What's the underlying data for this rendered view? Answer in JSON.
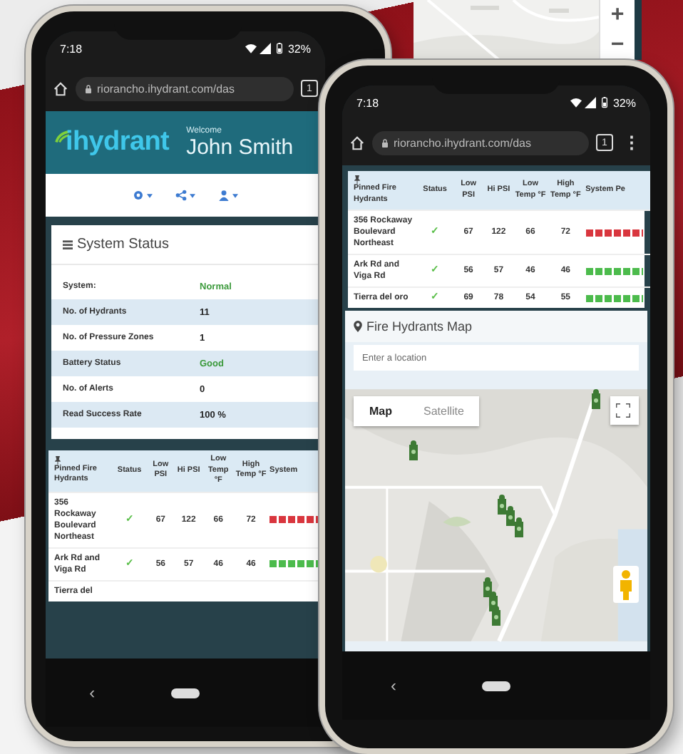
{
  "background": {
    "map_controls": [
      "+",
      "−"
    ]
  },
  "phones": [
    {
      "status_bar": {
        "time": "7:18",
        "battery": "32%"
      },
      "browser": {
        "url": "riorancho.ihydrant.com/das",
        "tab_count": "1"
      },
      "sections": [
        {
          "kind": "header",
          "logo": "ihydrant",
          "welcome": "Welcome",
          "user": "John Smith"
        },
        {
          "kind": "toolbar"
        },
        {
          "kind": "status_panel",
          "title": "System Status",
          "rows": [
            {
              "label": "System:",
              "value": "Normal",
              "color": "#3c9a3c"
            },
            {
              "label": "No. of Hydrants",
              "value": "11",
              "color": "#222222"
            },
            {
              "label": "No. of Pressure Zones",
              "value": "1",
              "color": "#222222"
            },
            {
              "label": "Battery Status",
              "value": "Good",
              "color": "#3c9a3c"
            },
            {
              "label": "No. of Alerts",
              "value": "0",
              "color": "#222222"
            },
            {
              "label": "Read Success Rate",
              "value": "100 %",
              "color": "#222222"
            }
          ]
        },
        {
          "kind": "table",
          "columns": [
            "Pinned Fire Hydrants",
            "Status",
            "Low PSI",
            "Hi PSI",
            "Low Temp °F",
            "High Temp °F",
            "System"
          ],
          "rows": [
            {
              "cells": [
                "356 Rockaway Boulevard Northeast",
                "✓",
                "67",
                "122",
                "66",
                "72"
              ],
              "color": "#d9363e"
            },
            {
              "cells": [
                "Ark Rd and Viga Rd",
                "✓",
                "56",
                "57",
                "46",
                "46"
              ],
              "color": "#4cbb4c"
            },
            {
              "cells": [
                "Tierra del"
              ]
            }
          ]
        }
      ],
      "nav": {
        "back": "‹"
      }
    },
    {
      "status_bar": {
        "time": "7:18",
        "battery": "32%"
      },
      "browser": {
        "url": "riorancho.ihydrant.com/das",
        "tab_count": "1",
        "menu": "⋮"
      },
      "sections": [
        {
          "kind": "table",
          "columns": [
            "Pinned Fire Hydrants",
            "Status",
            "Low PSI",
            "Hi PSI",
            "Low Temp °F",
            "High Temp °F",
            "System Pe"
          ],
          "rows": [
            {
              "cells": [
                "356 Rockaway Boulevard Northeast",
                "✓",
                "67",
                "122",
                "66",
                "72"
              ],
              "color": "#d9363e"
            },
            {
              "cells": [
                "Ark Rd and Viga Rd",
                "✓",
                "56",
                "57",
                "46",
                "46"
              ],
              "color": "#4cbb4c"
            },
            {
              "cells": [
                "Tierra del oro",
                "✓",
                "69",
                "78",
                "54",
                "55"
              ],
              "color": "#4cbb4c"
            }
          ]
        },
        {
          "kind": "map",
          "title": "Fire Hydrants Map",
          "placeholder": "Enter a location",
          "map_types": [
            {
              "label": "Map",
              "selected": true
            },
            {
              "label": "Satellite",
              "selected": false
            }
          ]
        }
      ],
      "nav": {
        "back": "‹"
      }
    }
  ]
}
